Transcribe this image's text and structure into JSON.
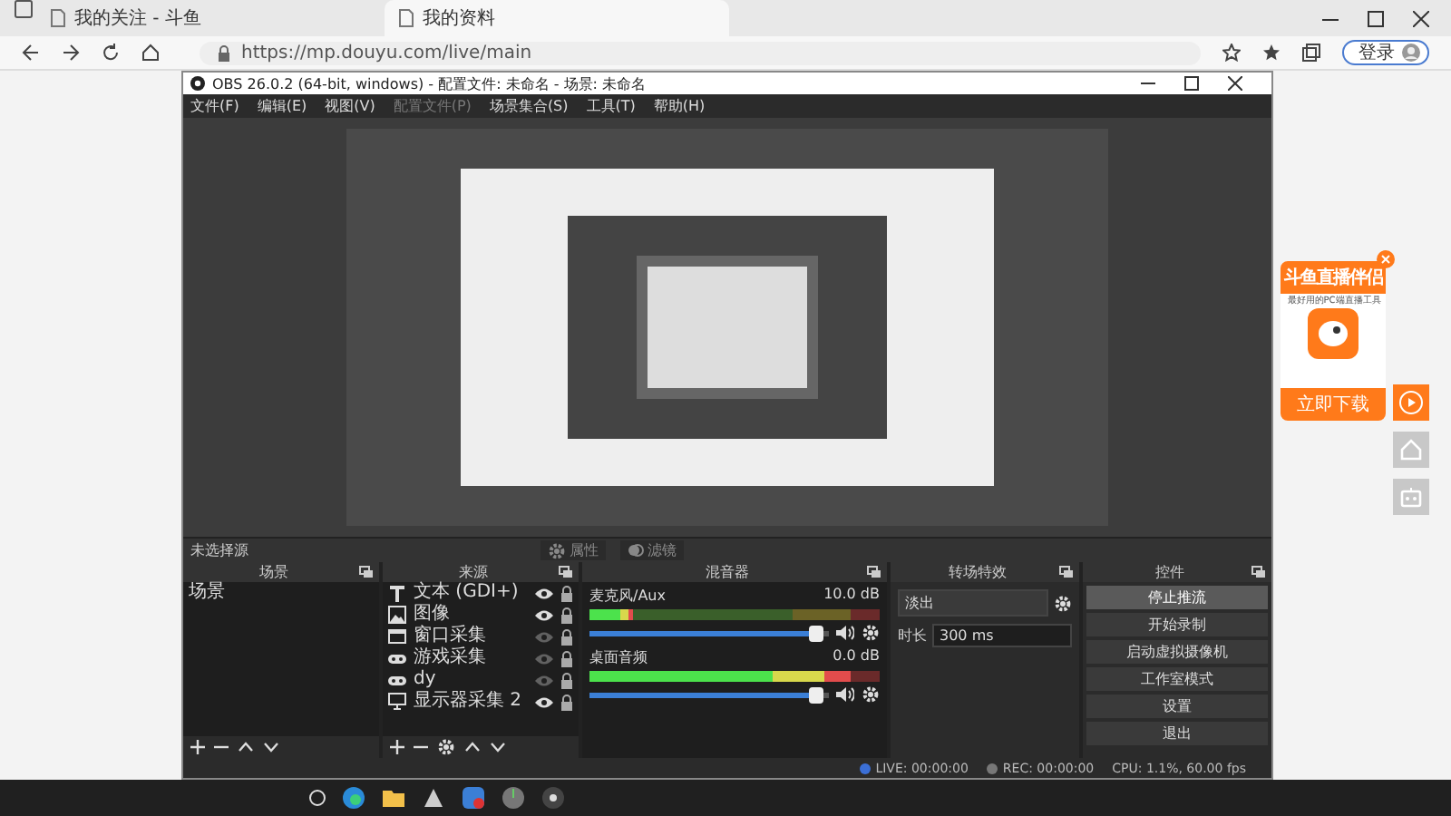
{
  "browser": {
    "tabs": [
      {
        "label": "我的关注 - 斗鱼",
        "selected": false
      },
      {
        "label": "我的资料",
        "selected": true
      }
    ],
    "url": "https://mp.douyu.com/live/main",
    "login_button": "登录"
  },
  "obs": {
    "title": "OBS 26.0.2 (64-bit, windows) - 配置文件: 未命名 - 场景: 未命名",
    "menu": [
      {
        "label": "文件(F)",
        "disabled": false
      },
      {
        "label": "编辑(E)",
        "disabled": false
      },
      {
        "label": "视图(V)",
        "disabled": false
      },
      {
        "label": "配置文件(P)",
        "disabled": true
      },
      {
        "label": "场景集合(S)",
        "disabled": false
      },
      {
        "label": "工具(T)",
        "disabled": false
      },
      {
        "label": "帮助(H)",
        "disabled": false
      }
    ],
    "source_bar": {
      "label": "未选择源",
      "properties": "属性",
      "filters": "滤镜"
    },
    "docks": {
      "scenes": "场景",
      "sources": "来源",
      "mixer": "混音器",
      "transitions": "转场特效",
      "controls": "控件"
    },
    "scenes": [
      {
        "name": "场景",
        "selected": false
      }
    ],
    "sources": [
      {
        "name": "文本 (GDI+)",
        "kind": "text",
        "visible": true
      },
      {
        "name": "图像",
        "kind": "image",
        "visible": true
      },
      {
        "name": "窗口采集",
        "kind": "window",
        "visible": false
      },
      {
        "name": "游戏采集",
        "kind": "game",
        "visible": false
      },
      {
        "name": "dy",
        "kind": "game",
        "visible": false
      },
      {
        "name": "显示器采集 2",
        "kind": "display",
        "visible": true
      }
    ],
    "mixer": [
      {
        "name": "麦克风/Aux",
        "reading": "10.0 dB",
        "level": 0.95
      },
      {
        "name": "桌面音频",
        "reading": "0.0 dB",
        "level": 0.95
      }
    ],
    "transition": {
      "type": "淡出",
      "duration_label": "时长",
      "duration": "300 ms"
    },
    "controls": [
      {
        "label": "停止推流",
        "active": true
      },
      {
        "label": "开始录制",
        "active": false
      },
      {
        "label": "启动虚拟摄像机",
        "active": false
      },
      {
        "label": "工作室模式",
        "active": false
      },
      {
        "label": "设置",
        "active": false
      },
      {
        "label": "退出",
        "active": false
      }
    ],
    "status": [
      "LIVE: 00:00:00",
      "REC: 00:00:00",
      "CPU: 1.1%, 60.00 fps"
    ]
  },
  "ad": {
    "title": "斗鱼直播伴侣",
    "subtitle": "最好用的PC端直播工具",
    "button": "立即下载"
  }
}
